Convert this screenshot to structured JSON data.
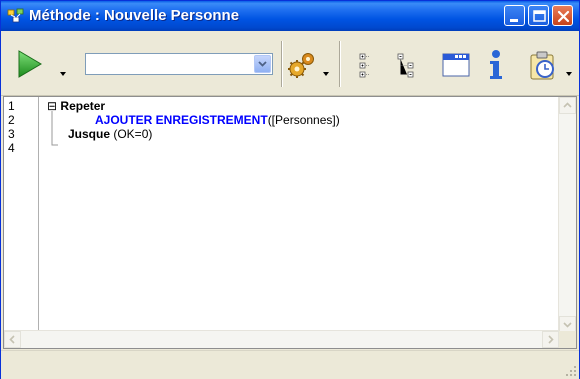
{
  "window": {
    "title": "Méthode : Nouvelle Personne"
  },
  "title_buttons": [
    {
      "name": "minimize",
      "icon": "minimize-icon"
    },
    {
      "name": "maximize",
      "icon": "maximize-icon"
    },
    {
      "name": "close",
      "icon": "close-icon"
    }
  ],
  "toolbar": {
    "run": {
      "icon": "play-icon",
      "color": "#2fa82f"
    },
    "search": {
      "icon": "magnifier-icon",
      "value": "",
      "placeholder": ""
    },
    "tools": [
      {
        "icon": "gears-icon"
      },
      {
        "icon": "expand-tree-icon"
      },
      {
        "icon": "collapse-tree-icon"
      },
      {
        "icon": "window-list-icon"
      },
      {
        "icon": "info-icon"
      },
      {
        "icon": "clipboard-timer-icon"
      }
    ]
  },
  "editor": {
    "line_numbers": [
      "1",
      "2",
      "3",
      "4"
    ],
    "lines": [
      {
        "fold": "⊟",
        "keyword": "Repeter",
        "rest": ""
      },
      {
        "command": "AJOUTER ENREGISTREMENT",
        "rest": "([Personnes])"
      },
      {
        "keyword": "Jusque",
        "rest": " (OK=0)"
      },
      {
        "text": ""
      }
    ]
  },
  "colors": {
    "titlebar": "#0054e3",
    "command": "#0000ff",
    "keyword": "#000000",
    "chrome": "#ece9d8"
  },
  "statusbar": {
    "text": ""
  }
}
